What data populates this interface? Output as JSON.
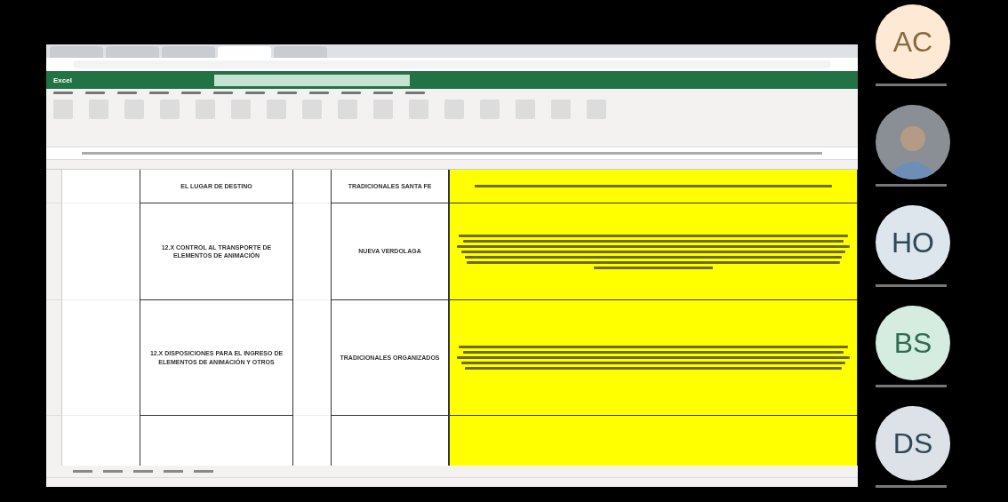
{
  "shared_screen": {
    "app_title": "Excel",
    "rows": [
      {
        "topic": "EL LUGAR DE DESTINO",
        "group": "TRADICIONALES SANTA FE"
      },
      {
        "topic": "12.X CONTROL AL TRANSPORTE DE ELEMENTOS DE ANIMACIÓN",
        "group": "NUEVA VERDOLAGA"
      },
      {
        "topic": "12.X DISPOSICIONES PARA EL INGRESO DE ELEMENTOS DE ANIMACIÓN Y OTROS",
        "group": "TRADICIONALES ORGANIZADOS"
      }
    ]
  },
  "participants": [
    {
      "kind": "initials",
      "initials": "AC",
      "color": "#fde9d4"
    },
    {
      "kind": "video"
    },
    {
      "kind": "initials",
      "initials": "HO",
      "color": "#dde6ec"
    },
    {
      "kind": "initials",
      "initials": "BS",
      "color": "#d5ece1"
    },
    {
      "kind": "initials",
      "initials": "DS",
      "color": "#dde1e8"
    }
  ]
}
